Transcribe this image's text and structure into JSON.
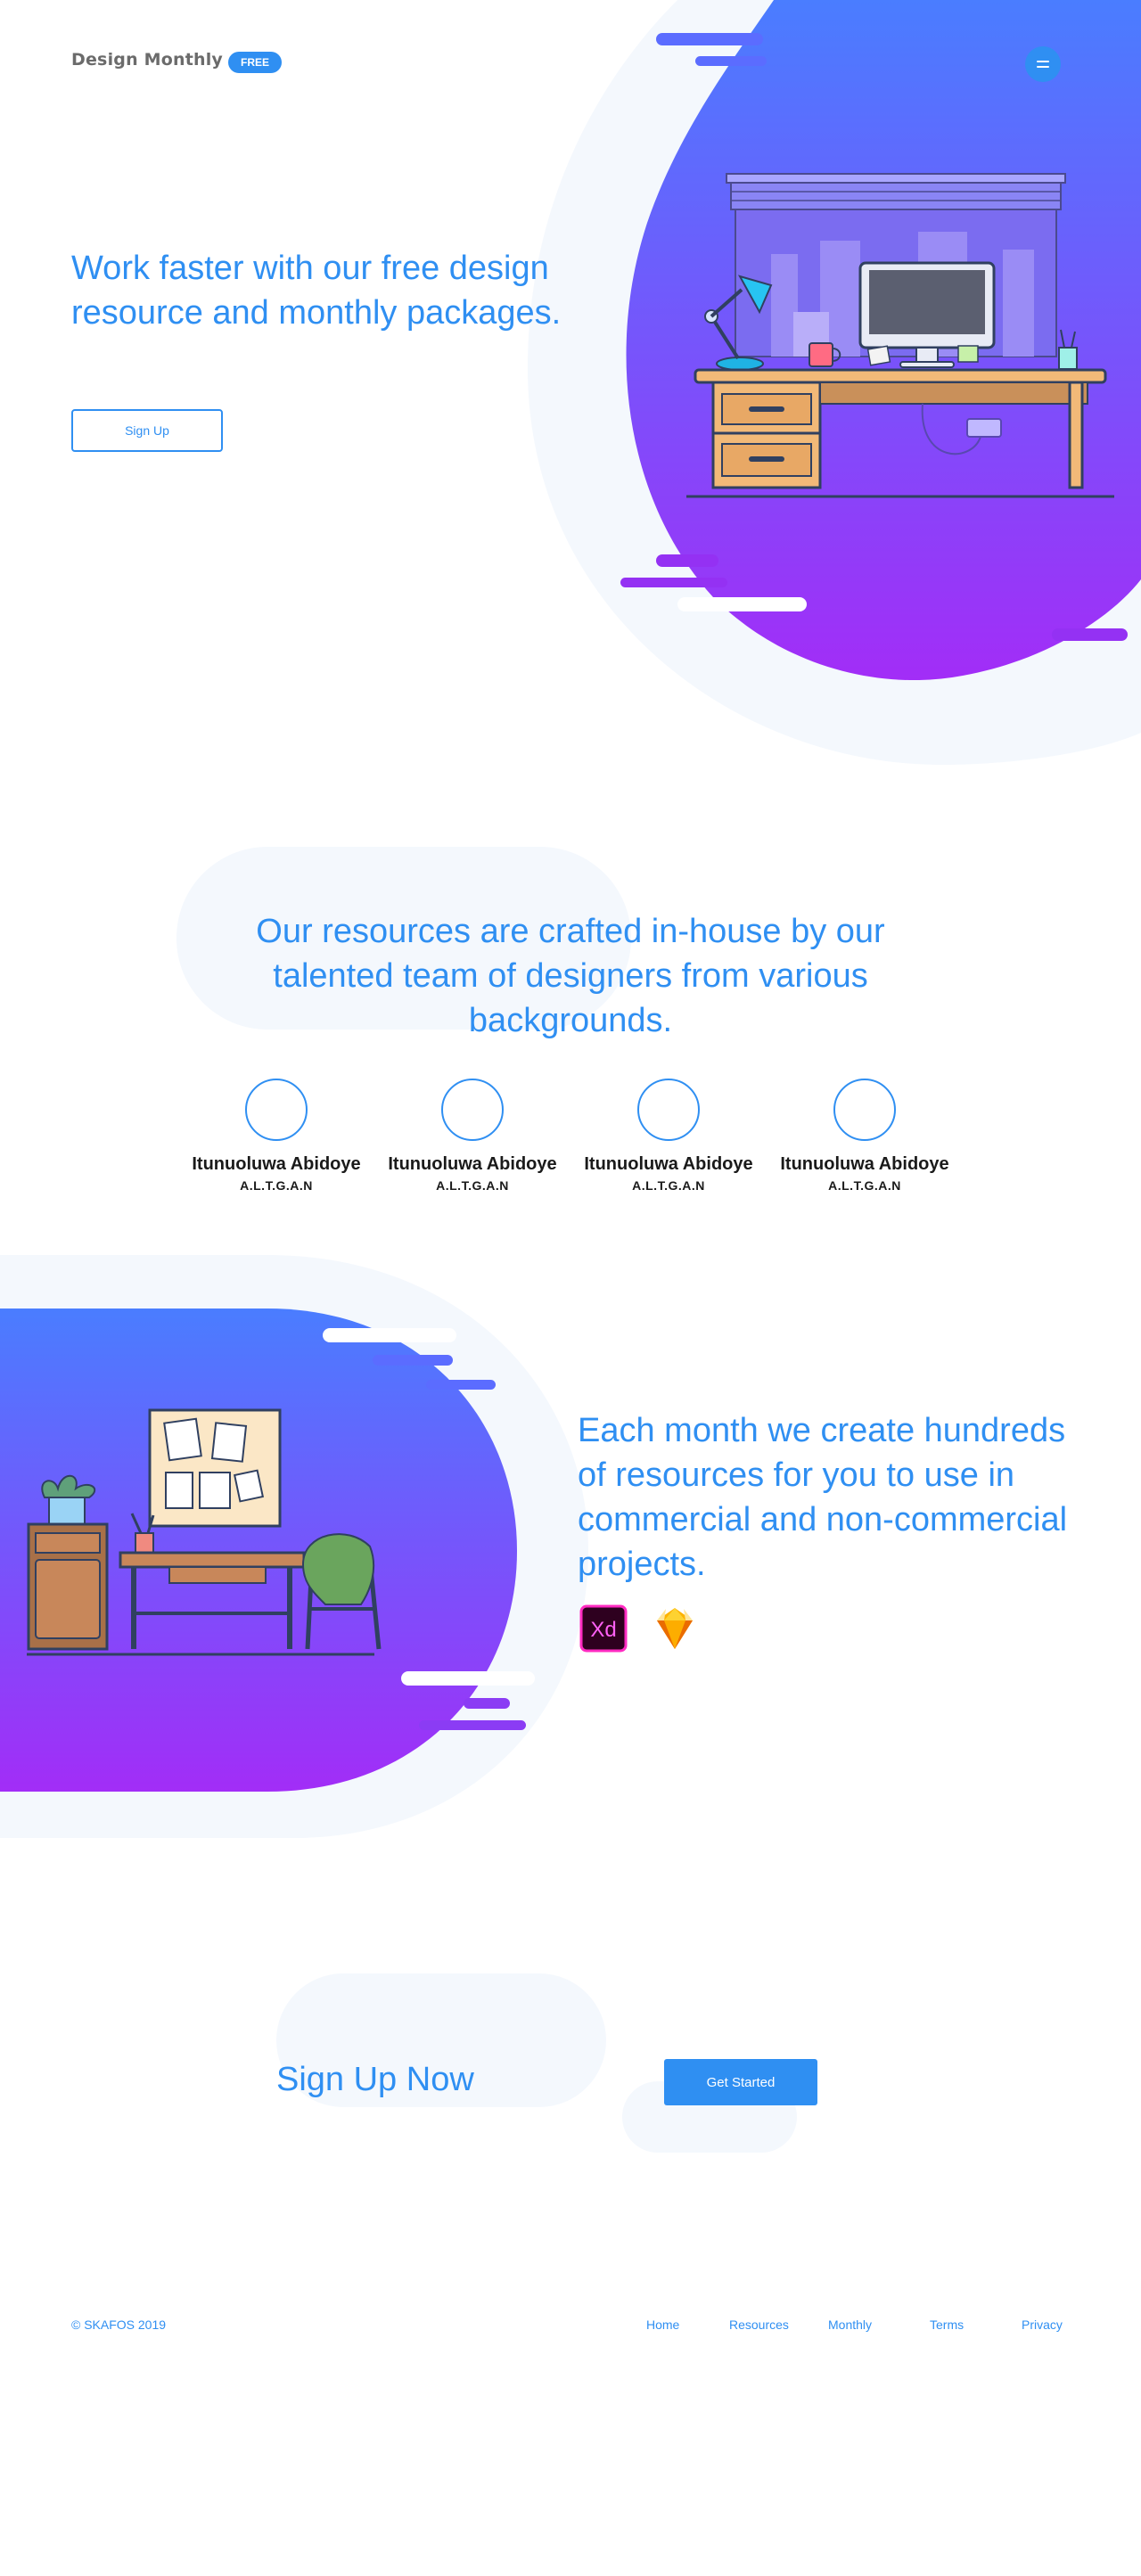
{
  "colors": {
    "accent": "#2f8ff2",
    "gradient_top": "#4a7dff",
    "gradient_bottom": "#a22df7",
    "soft_bg": "#f4f8fd"
  },
  "header": {
    "logo": "Design Monthly",
    "badge": "FREE",
    "menu_icon": "hamburger-menu-icon"
  },
  "hero": {
    "title": "Work faster with our free design resource and monthly packages.",
    "button": "Sign Up"
  },
  "team": {
    "title": "Our resources are crafted in-house by our talented team of designers from various backgrounds.",
    "members": [
      {
        "name": "Itunuoluwa Abidoye",
        "role": "A.L.T.G.A.N"
      },
      {
        "name": "Itunuoluwa Abidoye",
        "role": "A.L.T.G.A.N"
      },
      {
        "name": "Itunuoluwa Abidoye",
        "role": "A.L.T.G.A.N"
      },
      {
        "name": "Itunuoluwa Abidoye",
        "role": "A.L.T.G.A.N"
      }
    ]
  },
  "features": {
    "title": "Each month we create hundreds of resources for you to use in commercial and non-commercial projects.",
    "apps": [
      {
        "icon": "adobe-xd-icon",
        "label": "Xd"
      },
      {
        "icon": "sketch-icon"
      }
    ]
  },
  "cta": {
    "title": "Sign Up Now",
    "button": "Get Started"
  },
  "footer": {
    "copyright": "© SKAFOS 2019",
    "links": [
      "Home",
      "Resources",
      "Monthly",
      "Terms",
      "Privacy"
    ]
  }
}
